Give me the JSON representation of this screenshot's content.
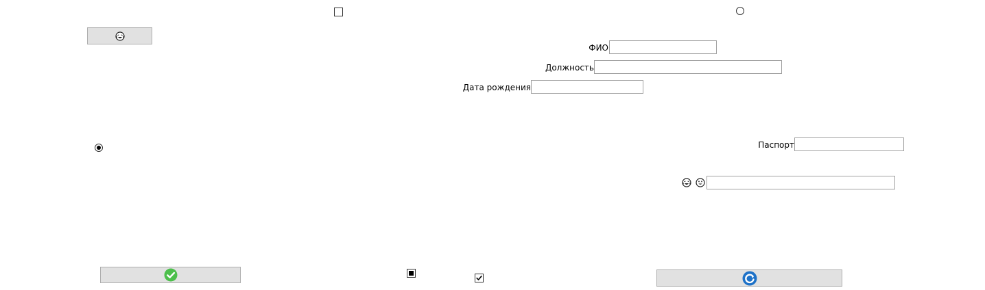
{
  "window": {
    "background": "#ffffff"
  },
  "controls": {
    "top_checkbox": {
      "state": "unchecked"
    },
    "top_radio": {
      "state": "unselected"
    },
    "emoji_button": {
      "icon": "laughing-crying-face-icon"
    },
    "left_radio": {
      "state": "selected"
    },
    "ok_button": {
      "icon": "green-check-circle-icon",
      "accent": "#4cbf4b"
    },
    "indeterminate_checkbox": {
      "state": "indeterminate"
    },
    "checked_checkbox": {
      "state": "checked",
      "glyph": "✔"
    },
    "refresh_button": {
      "icon": "blue-refresh-icon",
      "accent": "#1e72c8"
    }
  },
  "form": {
    "fio": {
      "label": "ФИО",
      "value": ""
    },
    "position": {
      "label": "Должность",
      "value": ""
    },
    "birth_date": {
      "label": "Дата рождения",
      "value": ""
    },
    "passport": {
      "label": "Паспорт",
      "value": ""
    },
    "emoji_field": {
      "icons": [
        "laughing-crying-face-icon",
        "grinning-face-icon"
      ],
      "value": ""
    }
  }
}
